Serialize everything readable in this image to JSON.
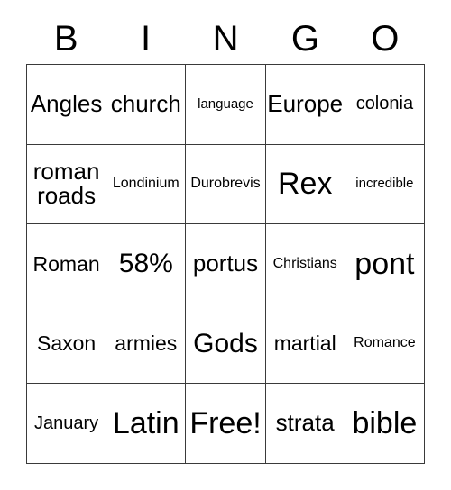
{
  "header": {
    "letters": [
      "B",
      "I",
      "N",
      "G",
      "O"
    ]
  },
  "grid": {
    "rows": 5,
    "columns": 5,
    "border_color": "#3a3a3a",
    "cell_background": "#ffffff",
    "text_color": "#000000",
    "cells": [
      {
        "text": "Angles",
        "size": "fs-l"
      },
      {
        "text": "church",
        "size": "fs-l"
      },
      {
        "text": "language",
        "size": "fs-xxs"
      },
      {
        "text": "Europe",
        "size": "fs-l"
      },
      {
        "text": "colonia",
        "size": "fs-s"
      },
      {
        "text": "roman\nroads",
        "size": "fs-l"
      },
      {
        "text": "Londinium",
        "size": "fs-xs"
      },
      {
        "text": "Durobrevis",
        "size": "fs-xs"
      },
      {
        "text": "Rex",
        "size": "fs-xxl"
      },
      {
        "text": "incredible",
        "size": "fs-xxs"
      },
      {
        "text": "Roman",
        "size": "fs-m"
      },
      {
        "text": "58%",
        "size": "fs-xl"
      },
      {
        "text": "portus",
        "size": "fs-l"
      },
      {
        "text": "Christians",
        "size": "fs-xs"
      },
      {
        "text": "pont",
        "size": "fs-xxl"
      },
      {
        "text": "Saxon",
        "size": "fs-m"
      },
      {
        "text": "armies",
        "size": "fs-m"
      },
      {
        "text": "Gods",
        "size": "fs-xl"
      },
      {
        "text": "martial",
        "size": "fs-m"
      },
      {
        "text": "Romance",
        "size": "fs-xs"
      },
      {
        "text": "January",
        "size": "fs-s"
      },
      {
        "text": "Latin",
        "size": "fs-xxl"
      },
      {
        "text": "Free!",
        "size": "fs-xxl"
      },
      {
        "text": "strata",
        "size": "fs-l"
      },
      {
        "text": "bible",
        "size": "fs-xxl"
      }
    ]
  }
}
